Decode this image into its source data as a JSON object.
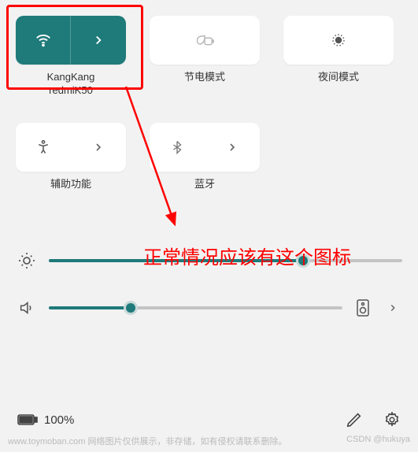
{
  "tiles": {
    "wifi": {
      "label": "KangKang\nredmiK50"
    },
    "powersave": {
      "label": "节电模式"
    },
    "nightmode": {
      "label": "夜间模式"
    },
    "accessibility": {
      "label": "辅助功能"
    },
    "bluetooth": {
      "label": "蓝牙"
    }
  },
  "sliders": {
    "brightness": {
      "value": 72
    },
    "volume": {
      "value": 28
    }
  },
  "battery": {
    "text": "100%"
  },
  "annotation": {
    "text": "正常情况应该有这个图标"
  },
  "watermark": {
    "left": "www.toymoban.com  网络图片仅供展示，非存储，如有侵权请联系删除。",
    "right": "CSDN @hukuya"
  },
  "colors": {
    "accent": "#1f7a7a",
    "highlight": "#ff0000"
  }
}
